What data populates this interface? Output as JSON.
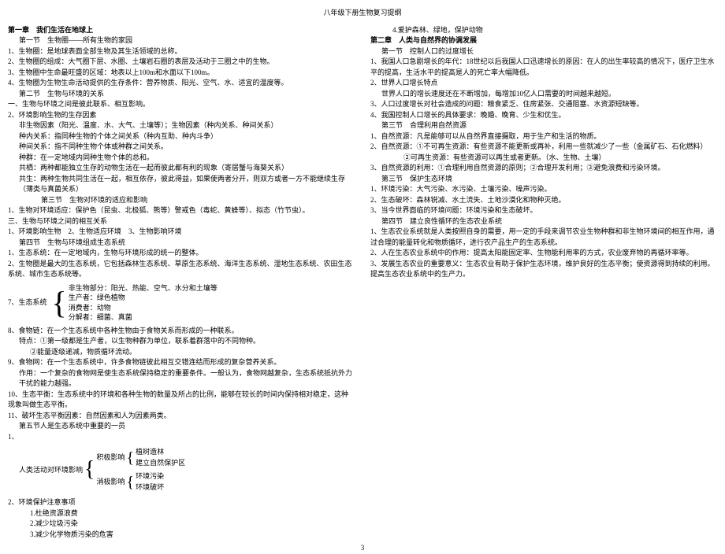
{
  "header": "八年级下册生物复习提纲",
  "left": {
    "ch1_title": "第一章　我们生活在地球上",
    "s1_title": "第一节　生物圈——所有生物的家园",
    "l1": "1、生物圈：是地球表面全部生物及其生活领域的总称。",
    "l2": "2、生物圈的组成：大气圈下层、水圈、土壤岩石圈的表层及活动于三圈之中的生物。",
    "l3": "3、生物圈中生命最旺盛的区域：地表以上100m和水面以下100m。",
    "l4": "4、生物圈为生物生命活动提供的生存条件：营养物质、阳光、空气、水、适宜的温度等。",
    "s2_title": "第二节　生物与环境的关系",
    "s2_sub": "一、生物与环境之间是彼此联系、相互影响。",
    "l5": "2、环境影响生物的生存因素",
    "l5a": "非生物因素（阳光、温度、水、大气、土壤等）；生物因素（种内关系、种间关系）",
    "l5b": "种内关系：指同种生物的个体之间关系（种内互助、种内斗争）",
    "l5c": "种间关系：指不同种生物个体或种群之间关系。",
    "l5d": "种群：在一定地域内同种生物个体的总和。",
    "l5e": "共栖：两种都能独立生存的动物生活在一起而彼此都有利的现象（寄居蟹与海葵关系）",
    "l5f": "共生：两种生物共同生活在一起，相互依存，彼此得益，如果使两者分开，则双方或者一方不能继续生存（薄类与真菌关系）",
    "s3_title": "第三节　生物对环境的适应和影响",
    "l6": "1、生物对环境适应：保护色（昆虫、北极狐、熊等）警戒色（毒蛇、黄蜂等）、拟态（竹节虫）。",
    "l7": "三、生物与环境之间的相互关系",
    "l8": "1、环境影响生物　2、生物适应环境　3、生物影响环境",
    "s4_title": "第四节　生物与环境组成生态系统",
    "l9": "1、生态系统：在一定地域内，生物与环境形成的统一的整体。",
    "l10": "2、生物圈是最大的生态系统，它包括森林生态系统、草原生态系统、海洋生态系统、湿地生态系统、农田生态系统、城市生态系统等。",
    "l11_label": "7、生态系统",
    "l11a": "非生物部分：阳光、热能、空气、水分和土壤等",
    "l11b": "生产者：绿色植物",
    "l11c": "消费者：动物",
    "l11d": "分解者：细菌、真菌",
    "l12": "8、食物链：在一个生态系统中各种生物由于食物关系而形成的一种联系。",
    "l12a": "特点：①第一级都是生产者，以生物种群为单位，联系着群落中的不同物种。",
    "l12b": "②能量逐级递减，物质循环流动。",
    "l13": "9、食物网：在一个生态系统中，许多食物链彼此相互交错连结而形成的复杂营养关系。",
    "l13a": "作用：一个复杂的食物网是使生态系统保持稳定的重要条件。一般认为，食物网越复杂，生态系统抵抗外力干扰的能力越强。",
    "l14": "10、生态平衡：生态系统中的环境和各种生物的数量及所占的比例，能够在较长的时间内保持相对稳定，这种现象叫做生态平衡。",
    "l15": "11、破坏生态平衡因素：自然因素和人为因素两类。",
    "l16": "第五节人是生态系统中重要的一员",
    "tree_label": "人类活动对环境影响",
    "tree_a": "积极影响",
    "tree_a1": "植树造林",
    "tree_a2": "建立自然保护区",
    "tree_b": "消极影响",
    "tree_b1": "环境污染",
    "tree_b2": "环境破坏",
    "l17": "2、环境保护注意事项",
    "l17a": "1.杜绝资源浪费",
    "l17b": "2.减少垃圾污染",
    "l17c": "3.减少化学物质污染的危害"
  },
  "right": {
    "r0": "4.爱护森林、绿地，保护动物",
    "ch2_title": "第二章　人类与自然界的协调发展",
    "s1_title": "第一节　控制人口的过度增长",
    "r1": "1、我国人口急剧增长的年代：18世纪以后我国人口迅速增长的原因：在人的出生率较高的情况下，医疗卫生水平的提高，生活水平的提高是人的死亡率大幅降低。",
    "r2": "2、世界人口增长特点",
    "r2a": "世界人口的增长速度还在不断增加，每增加10亿人口需要的时间越来越短。",
    "r3": "3、人口过度增长对社会造成的问题：粮食紧乏、住房紧张、交通阻塞、水资源短缺等。",
    "r4": "4、我国控制人口增长的具体要求：晚婚、晚育、少生和优生。",
    "s3_title": "第三节　合理利用自然资源",
    "r5": "1、自然资源：凡是能够可以从自然界直接摄取，用于生产和生活的物质。",
    "r6": "2、自然资源：①不可再生资源：有些资源不能更新或再补，利用一些就减少了一些（金属矿石、石化燃料）",
    "r6a": "②可再生资源：有些资源可以再生或者更新。（水、生物、土壤）",
    "r7": "3、自然资源的利用：①合理利用自然资源的原则；②合理开发利用；③避免浪费和污染环境。",
    "s3b_title": "第三节　保护生态环境",
    "r8": "1、环境污染：大气污染、水污染、土壤污染、噪声污染。",
    "r9": "2、生态破坏：森林锐减、水土流失、土地沙漠化和物种灭绝。",
    "r10": "3、当今世界面临的环境问题：环境污染和生态破坏。",
    "s4_title": "第四节　建立良性循环的生态农业系统",
    "r11": "1、生态农业系统就是人类按照自身的需要，用一定的手段来调节农业生物种群和非生物环境间的相互作用，通过合理的能量转化和物质循环，进行农产品生产的生态系统。",
    "r12": "2、人在生态农业系统中的作用：提高太阳能固定率、生物能利用率的方式，农业废弃物的再循环率等。",
    "r13": "3、发展生态农业的重要意义：生态农业有助于保护生态环境，维护良好的生态平衡；使资源得到持续的利用。提高生态农业系统中的生产力。"
  },
  "page": "3"
}
